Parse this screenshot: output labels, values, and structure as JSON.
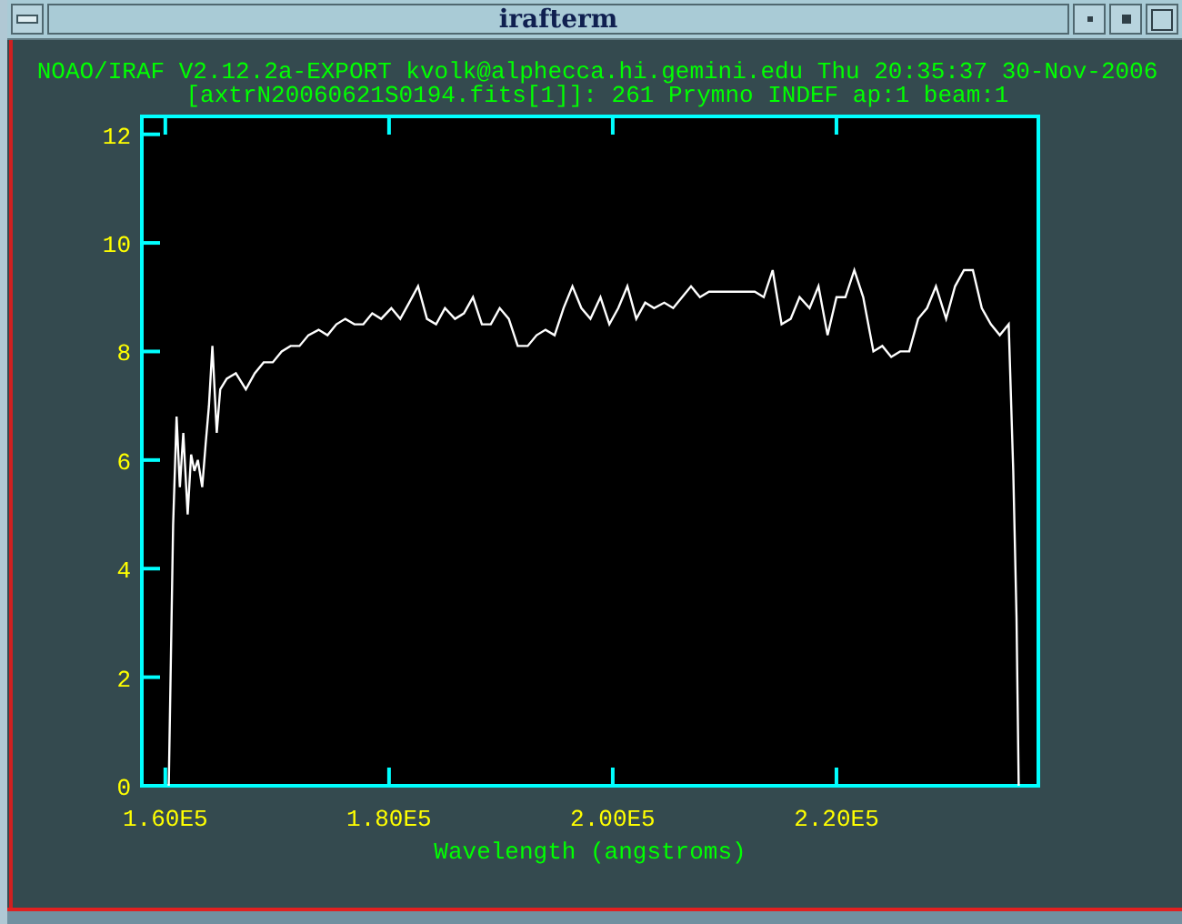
{
  "window": {
    "title": "irafterm"
  },
  "header": [
    "NOAO/IRAF V2.12.2a-EXPORT kvolk@alphecca.hi.gemini.edu Thu 20:35:37 30-Nov-2006",
    "[axtrN20060621S0194.fits[1]]: 261 Prymno INDEF ap:1 beam:1"
  ],
  "plot": {
    "chart_data": {
      "type": "line",
      "xlabel": "Wavelength (angstroms)",
      "xlim": [
        157900,
        238050
      ],
      "ylim": [
        0,
        12.33
      ],
      "xticks": [
        {
          "value": 160000,
          "label": "1.60E5"
        },
        {
          "value": 180000,
          "label": "1.80E5"
        },
        {
          "value": 200000,
          "label": "2.00E5"
        },
        {
          "value": 220000,
          "label": "2.20E5"
        }
      ],
      "yticks": [
        0,
        2,
        4,
        6,
        8,
        10,
        12
      ],
      "x": [
        160300,
        160700,
        161000,
        161300,
        161600,
        162000,
        162300,
        162600,
        162900,
        163300,
        163600,
        163900,
        164200,
        164600,
        164900,
        165500,
        166300,
        167200,
        168000,
        168800,
        169600,
        170400,
        171200,
        172000,
        172800,
        173700,
        174500,
        175300,
        176100,
        176900,
        177700,
        178500,
        179300,
        180200,
        181000,
        181800,
        182600,
        183400,
        184200,
        185000,
        185900,
        186700,
        187500,
        188300,
        189100,
        189900,
        190700,
        191500,
        192400,
        193200,
        194000,
        194800,
        195600,
        196400,
        197200,
        198000,
        198900,
        199700,
        200500,
        201300,
        202100,
        202900,
        203700,
        204600,
        205400,
        206200,
        207000,
        207800,
        208600,
        209400,
        210200,
        211100,
        211900,
        212700,
        213500,
        214300,
        215100,
        215900,
        216700,
        217600,
        218400,
        219200,
        220000,
        220800,
        221600,
        222400,
        223300,
        224100,
        224900,
        225700,
        226500,
        227300,
        228100,
        228900,
        229800,
        230600,
        231400,
        232200,
        233000,
        233800,
        234600,
        235400,
        235800,
        236100,
        236300
      ],
      "series": [
        {
          "color": "#ffffff",
          "values": [
            0,
            4.8,
            6.8,
            5.5,
            6.5,
            5.0,
            6.1,
            5.8,
            6.0,
            5.5,
            6.3,
            7.0,
            8.1,
            6.5,
            7.3,
            7.5,
            7.6,
            7.3,
            7.6,
            7.8,
            7.8,
            8.0,
            8.1,
            8.1,
            8.3,
            8.4,
            8.3,
            8.5,
            8.6,
            8.5,
            8.5,
            8.7,
            8.6,
            8.8,
            8.6,
            8.9,
            9.2,
            8.6,
            8.5,
            8.8,
            8.6,
            8.7,
            9.0,
            8.5,
            8.5,
            8.8,
            8.6,
            8.1,
            8.1,
            8.3,
            8.4,
            8.3,
            8.8,
            9.2,
            8.8,
            8.6,
            9.0,
            8.5,
            8.8,
            9.2,
            8.6,
            8.9,
            8.8,
            8.9,
            8.8,
            9.0,
            9.2,
            9.0,
            9.1,
            9.1,
            9.1,
            9.1,
            9.1,
            9.1,
            9.0,
            9.5,
            8.5,
            8.6,
            9.0,
            8.8,
            9.2,
            8.3,
            9.0,
            9.0,
            9.5,
            9.0,
            8.0,
            8.1,
            7.9,
            8.0,
            8.0,
            8.6,
            8.8,
            9.2,
            8.6,
            9.2,
            9.5,
            9.5,
            8.8,
            8.5,
            8.3,
            8.5,
            5.8,
            3.1,
            0
          ]
        }
      ]
    }
  }
}
